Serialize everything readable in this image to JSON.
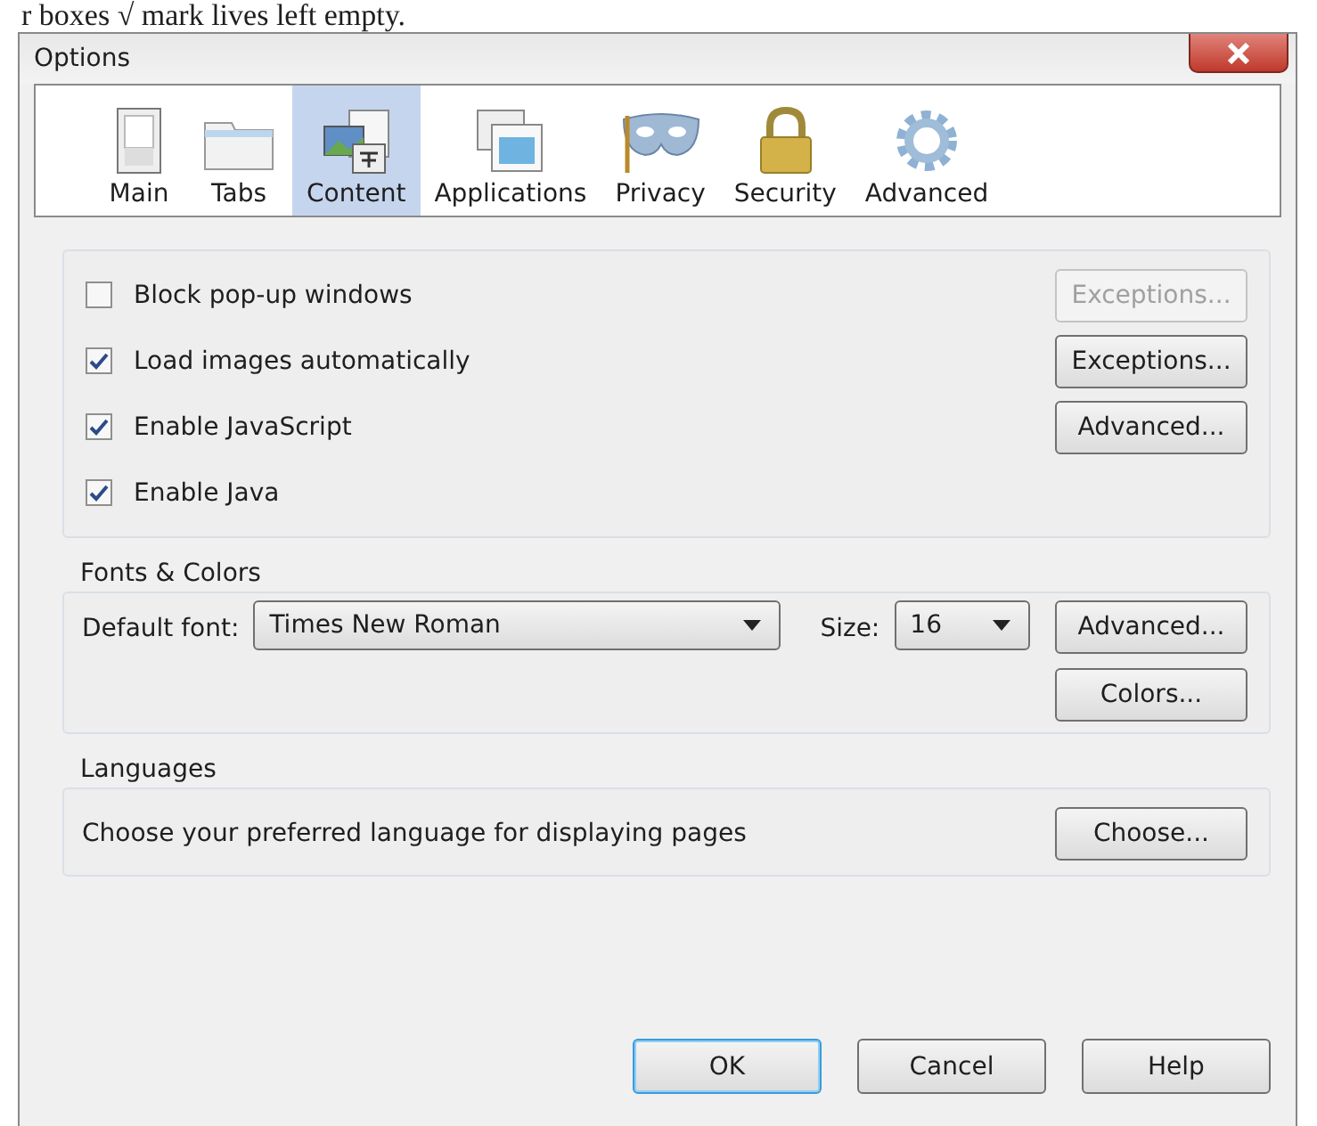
{
  "document_text": "r boxes √ mark lives left empty.",
  "window": {
    "title": "Options"
  },
  "tabs": [
    {
      "label": "Main",
      "selected": false
    },
    {
      "label": "Tabs",
      "selected": false
    },
    {
      "label": "Content",
      "selected": true
    },
    {
      "label": "Applications",
      "selected": false
    },
    {
      "label": "Privacy",
      "selected": false
    },
    {
      "label": "Security",
      "selected": false
    },
    {
      "label": "Advanced",
      "selected": false
    }
  ],
  "content_options": [
    {
      "label": "Block pop-up windows",
      "checked": false,
      "button": {
        "label": "Exceptions...",
        "disabled": true
      }
    },
    {
      "label": "Load images automatically",
      "checked": true,
      "button": {
        "label": "Exceptions...",
        "disabled": false
      }
    },
    {
      "label": "Enable JavaScript",
      "checked": true,
      "button": {
        "label": "Advanced...",
        "disabled": false
      }
    },
    {
      "label": "Enable Java",
      "checked": true
    }
  ],
  "fonts_colors": {
    "title": "Fonts & Colors",
    "default_font_label": "Default font:",
    "default_font": "Times New Roman",
    "size_label": "Size:",
    "size": "16",
    "buttons": [
      "Advanced...",
      "Colors..."
    ]
  },
  "languages": {
    "title": "Languages",
    "text": "Choose your preferred language for displaying pages",
    "button": "Choose..."
  },
  "buttons": [
    {
      "label": "OK",
      "default": true
    },
    {
      "label": "Cancel",
      "default": false
    },
    {
      "label": "Help",
      "default": false
    }
  ]
}
